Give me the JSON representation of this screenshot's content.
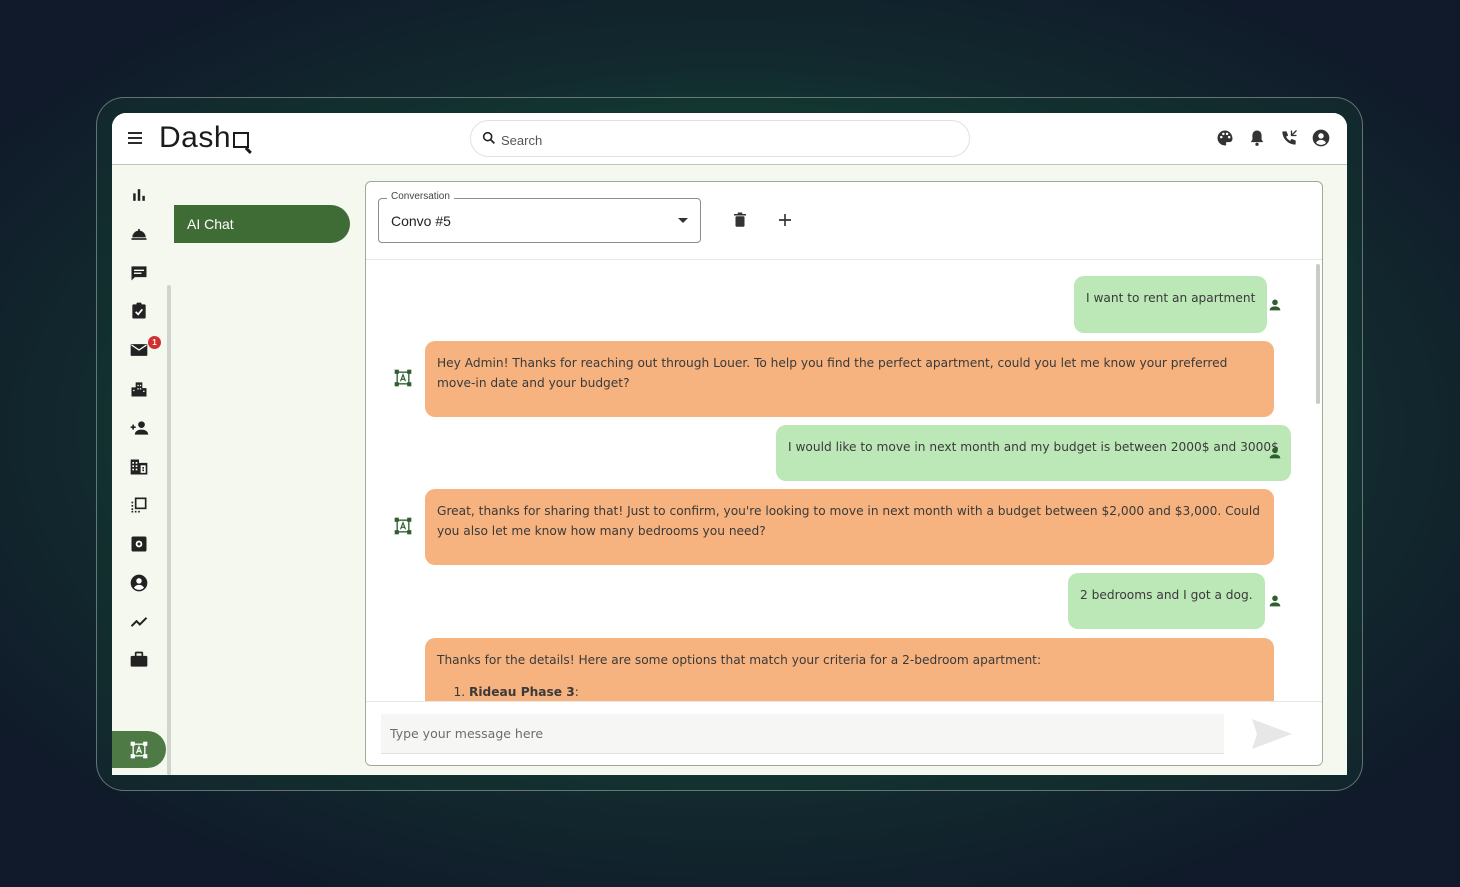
{
  "app": {
    "logo_text": "Dash"
  },
  "search": {
    "placeholder": "Search"
  },
  "header_icons": [
    "palette-icon",
    "bell-icon",
    "phone-icon",
    "account-circle-icon"
  ],
  "rail": {
    "icons": [
      "bar-chart-icon",
      "room-service-icon",
      "message-icon",
      "clipboard-check-icon",
      "mail-icon",
      "city-icon",
      "person-add-icon",
      "building-icon",
      "select-all-icon",
      "settings-box-icon",
      "account-icon",
      "trending-icon",
      "briefcase-icon",
      "ai-chat-icon"
    ],
    "mail_badge": "1"
  },
  "subnav": {
    "label": "AI Chat"
  },
  "conversation": {
    "label": "Conversation",
    "value": "Convo #5"
  },
  "messages": [
    {
      "role": "user",
      "text": "I want to rent an apartment"
    },
    {
      "role": "bot",
      "text": "Hey Admin! Thanks for reaching out through Louer. To help you find the perfect apartment, could you let me know your preferred move-in date and your budget?"
    },
    {
      "role": "user",
      "text": "I would like to move in next month and my budget is between 2000$ and 3000$"
    },
    {
      "role": "bot",
      "text": "Great, thanks for sharing that! Just to confirm, you're looking to move in next month with a budget between $2,000 and $3,000. Could you also let me know how many bedrooms you need?"
    },
    {
      "role": "user",
      "text": "2 bedrooms and I got a dog."
    },
    {
      "role": "bot",
      "text": "Thanks for the details! Here are some options that match your criteria for a 2-bedroom apartment:",
      "list_item": "Rideau Phase 3",
      "list_item_suffix": ":"
    }
  ],
  "composer": {
    "placeholder": "Type your message here"
  },
  "colors": {
    "accent": "#3f6b35",
    "user_bubble": "#bce8b8",
    "bot_bubble": "#f6b380",
    "badge": "#d32f2f"
  }
}
